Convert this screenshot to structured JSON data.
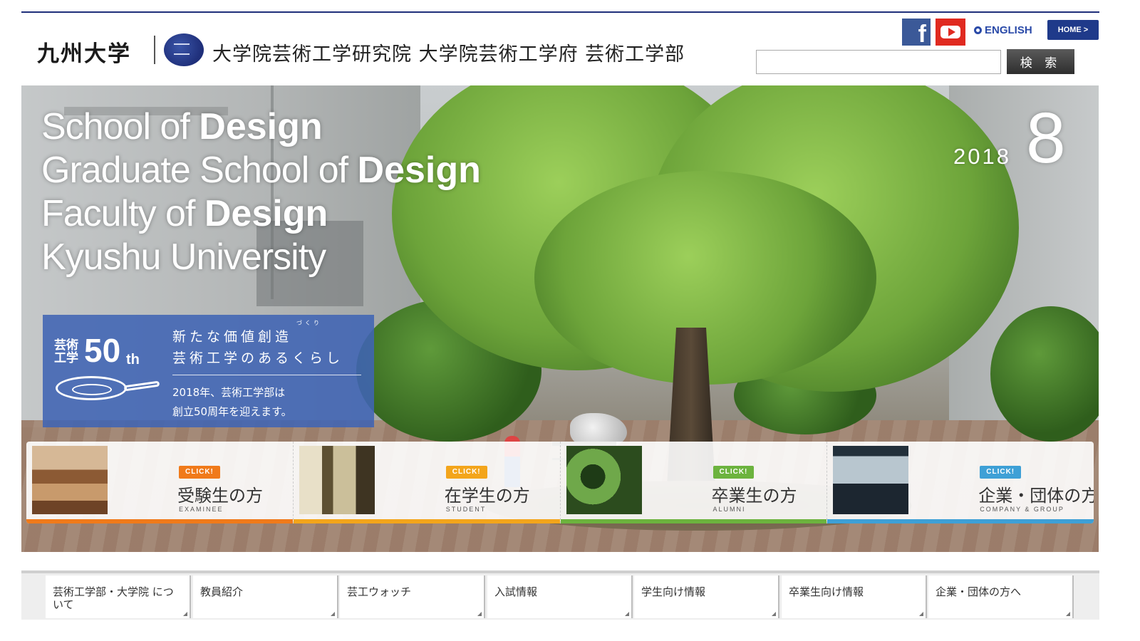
{
  "header": {
    "wordmark": "九州大学",
    "school_name": "大学院芸術工学研究院 大学院芸術工学府 芸術工学部",
    "facebook_icon": "facebook-icon",
    "youtube_icon": "youtube-icon",
    "facebook_glyph": "f",
    "english_label": "ENGLISH",
    "home_label": "HOME >",
    "search_value": "",
    "search_button": "検 索"
  },
  "hero": {
    "headline": [
      {
        "thin": "School of ",
        "bold": "Design"
      },
      {
        "thin": "Graduate School of ",
        "bold": "Design"
      },
      {
        "thin": "Faculty of ",
        "bold": "Design"
      },
      {
        "thin": "Kyushu University",
        "bold": ""
      }
    ],
    "year": "2018",
    "month": "8",
    "anniversary": {
      "label": "芸術工学",
      "number": "50",
      "suffix": "th",
      "ruby": "づくり",
      "tagline_1": "新たな価値創造",
      "tagline_2": "芸術工学のあるくらし",
      "text_1": "2018年、芸術工学部は",
      "text_2": "創立50周年を迎えます。"
    }
  },
  "cards": [
    {
      "click": "CLICK!",
      "title": "受験生の方",
      "sub": "EXAMINEE",
      "color": "#f07a1a"
    },
    {
      "click": "CLICK!",
      "title": "在学生の方",
      "sub": "STUDENT",
      "color": "#f3a51b"
    },
    {
      "click": "CLICK!",
      "title": "卒業生の方",
      "sub": "ALUMNI",
      "color": "#6cb33e"
    },
    {
      "click": "CLICK!",
      "title": "企業・団体の方",
      "sub": "COMPANY & GROUP",
      "color": "#3ea0d6"
    }
  ],
  "nav": [
    {
      "label": "芸術工学部・大学院 について"
    },
    {
      "label": "教員紹介"
    },
    {
      "label": "芸工ウォッチ"
    },
    {
      "label": "入試情報"
    },
    {
      "label": "学生向け情報"
    },
    {
      "label": "卒業生向け情報"
    },
    {
      "label": "企業・団体の方へ"
    }
  ]
}
